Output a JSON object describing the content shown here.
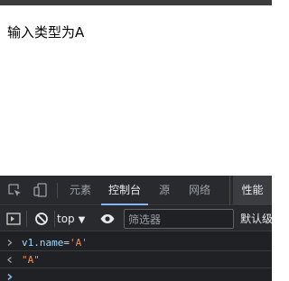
{
  "page": {
    "text": "输入类型为A"
  },
  "devtools": {
    "tabs": [
      {
        "label": "元素",
        "active": false
      },
      {
        "label": "控制台",
        "active": true
      },
      {
        "label": "源",
        "active": false
      },
      {
        "label": "网络",
        "active": false
      },
      {
        "label": "性能",
        "active": false
      }
    ],
    "toolbar": {
      "context": "top",
      "filter_placeholder": "筛选器",
      "levels": "默认级"
    },
    "console": {
      "input": {
        "var": "v1",
        "prop": ".name",
        "op": "=",
        "value": "'A'"
      },
      "output": "\"A\""
    },
    "colors": {
      "panel_bg": "#202124",
      "active_tab_underline": "#8ab4f8",
      "string": "#f28b54"
    }
  }
}
